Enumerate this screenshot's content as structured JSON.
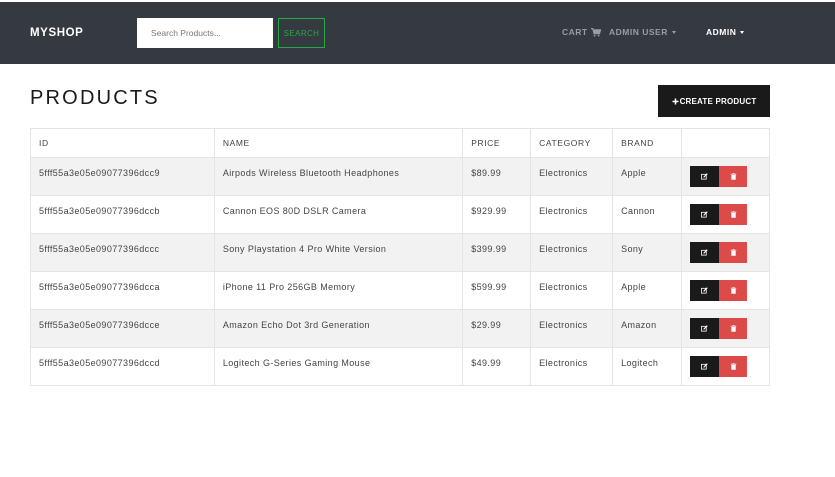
{
  "navbar": {
    "brand": "MYSHOP",
    "search_placeholder": "Search Products...",
    "search_button": "SEARCH",
    "cart_label": "CART",
    "user_menu": "ADMIN USER",
    "admin_menu": "ADMIN"
  },
  "page": {
    "title": "PRODUCTS",
    "create_button": "CREATE PRODUCT"
  },
  "table": {
    "headers": [
      "ID",
      "NAME",
      "PRICE",
      "CATEGORY",
      "BRAND",
      ""
    ],
    "rows": [
      {
        "id": "5fff55a3e05e09077396dcc9",
        "name": "Airpods Wireless Bluetooth Headphones",
        "price": "$89.99",
        "category": "Electronics",
        "brand": "Apple"
      },
      {
        "id": "5fff55a3e05e09077396dccb",
        "name": "Cannon EOS 80D DSLR Camera",
        "price": "$929.99",
        "category": "Electronics",
        "brand": "Cannon"
      },
      {
        "id": "5fff55a3e05e09077396dccc",
        "name": "Sony Playstation 4 Pro White Version",
        "price": "$399.99",
        "category": "Electronics",
        "brand": "Sony"
      },
      {
        "id": "5fff55a3e05e09077396dcca",
        "name": "iPhone 11 Pro 256GB Memory",
        "price": "$599.99",
        "category": "Electronics",
        "brand": "Apple"
      },
      {
        "id": "5fff55a3e05e09077396dcce",
        "name": "Amazon Echo Dot 3rd Generation",
        "price": "$29.99",
        "category": "Electronics",
        "brand": "Amazon"
      },
      {
        "id": "5fff55a3e05e09077396dccd",
        "name": "Logitech G-Series Gaming Mouse",
        "price": "$49.99",
        "category": "Electronics",
        "brand": "Logitech"
      }
    ]
  },
  "icons": {
    "cart": "shopping-cart-icon",
    "plus": "plus-icon",
    "edit": "edit-icon",
    "delete": "trash-icon"
  },
  "colors": {
    "navbar_bg": "#343a40",
    "search_accent": "#28a745",
    "dark_button": "#1a1a1a",
    "danger": "#dc4a4a",
    "striped_row": "#f2f2f2"
  }
}
